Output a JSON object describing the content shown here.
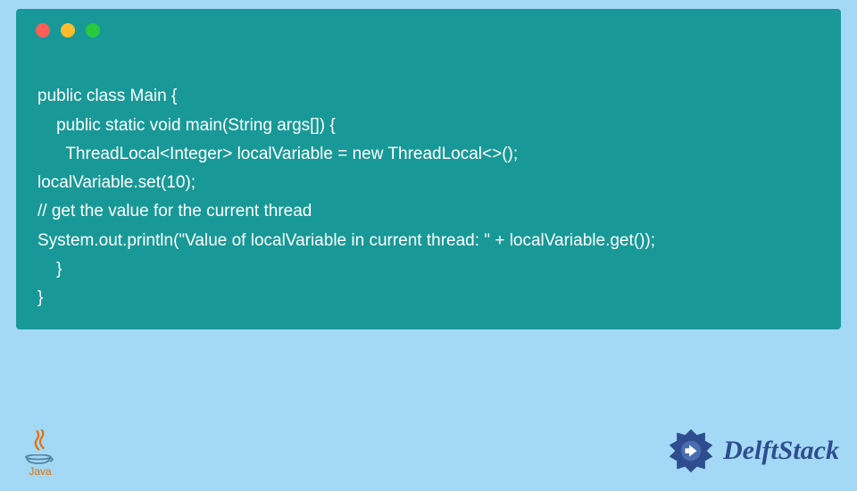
{
  "code": {
    "lines": [
      "public class Main {",
      "    public static void main(String args[]) {",
      "      ThreadLocal<Integer> localVariable = new ThreadLocal<>();",
      "localVariable.set(10);",
      "// get the value for the current thread",
      "System.out.println(\"Value of localVariable in current thread: \" + localVariable.get());",
      "    }",
      "}"
    ]
  },
  "branding": {
    "java_label": "Java",
    "delft_label": "DelftStack"
  },
  "colors": {
    "background": "#a3d9f5",
    "code_bg": "#189997",
    "code_text": "#ffffff",
    "java_orange": "#e76f00",
    "delft_blue": "#2e4d8f"
  }
}
